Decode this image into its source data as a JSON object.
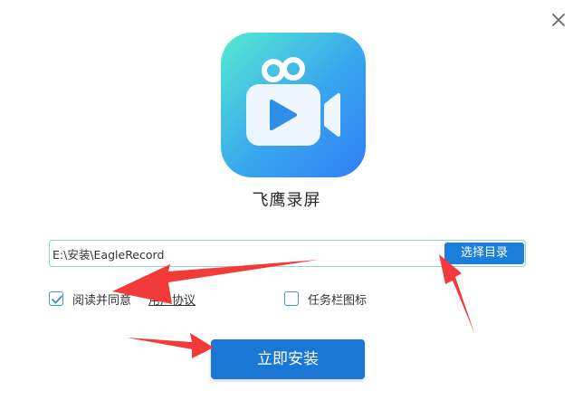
{
  "window": {
    "close_icon": "close-icon"
  },
  "app": {
    "name": "飞鹰录屏",
    "icon": "video-camera-icon"
  },
  "install_path": {
    "value": "E:\\安装\\EagleRecord",
    "browse_label": "选择目录"
  },
  "options": {
    "agree_label": "阅读并同意",
    "agreement_link": "用户协议",
    "agree_checked": true,
    "tray_label": "任务栏图标",
    "tray_checked": false
  },
  "install_button": {
    "label": "立即安装"
  },
  "colors": {
    "primary": "#1a77d6",
    "browse": "#1c7fdc",
    "icon_gradient_start": "#56ead1",
    "icon_gradient_end": "#2f7ff0",
    "annotation_arrow": "#f23a3a"
  }
}
